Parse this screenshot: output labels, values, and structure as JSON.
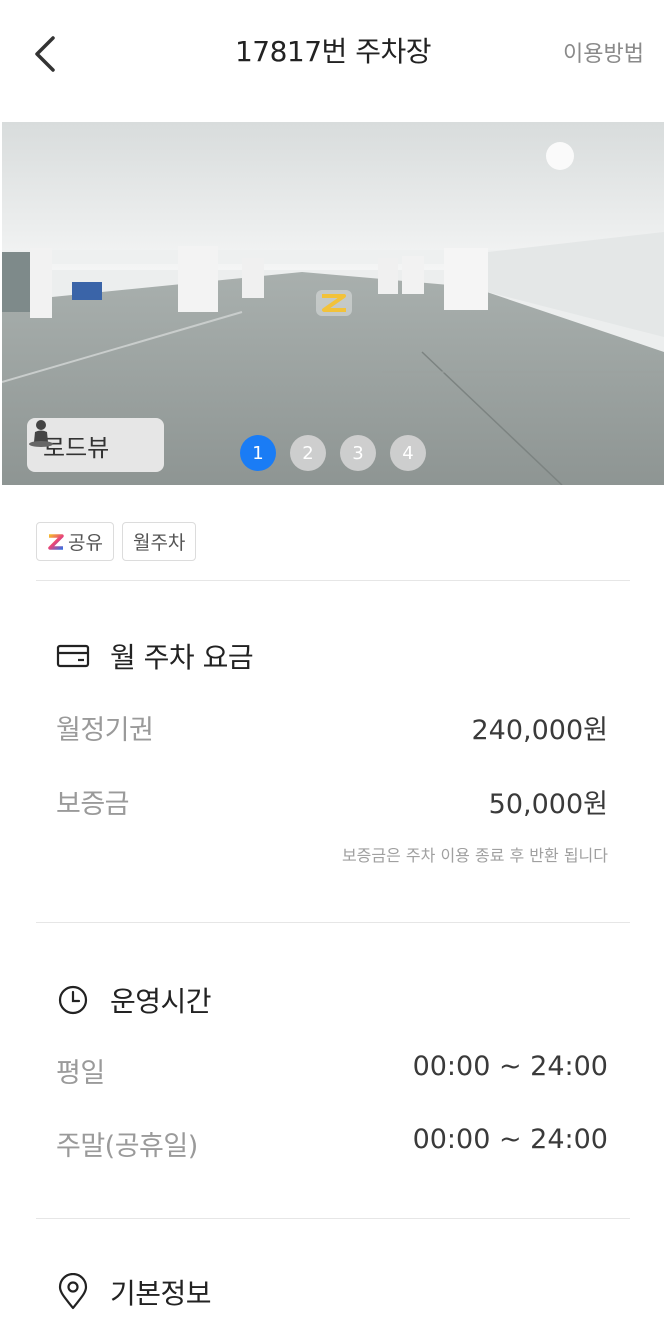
{
  "header": {
    "title": "17817번 주차장",
    "help_label": "이용방법"
  },
  "hero": {
    "roadview_label": "로드뷰",
    "pages": [
      "1",
      "2",
      "3",
      "4"
    ],
    "active_page": 1
  },
  "tags": [
    "공유",
    "월주차"
  ],
  "fee_section": {
    "title": "월 주차 요금",
    "rows": [
      {
        "label": "월정기권",
        "value": "240,000원"
      },
      {
        "label": "보증금",
        "value": "50,000원"
      }
    ],
    "note": "보증금은 주차 이용 종료 후 반환 됩니다"
  },
  "hours_section": {
    "title": "운영시간",
    "rows": [
      {
        "label": "평일",
        "value": "00:00 ~ 24:00"
      },
      {
        "label": "주말(공휴일)",
        "value": "00:00 ~ 24:00"
      }
    ]
  },
  "info_section": {
    "title": "기본정보"
  },
  "colors": {
    "accent": "#1a7cf5",
    "muted_text": "#9a9a9a",
    "divider": "#e6e6e6"
  },
  "icons": {
    "back": "chevron-left-icon",
    "roadview": "person-pin-icon",
    "fee": "card-icon",
    "hours": "clock-icon",
    "info": "location-pin-icon"
  }
}
